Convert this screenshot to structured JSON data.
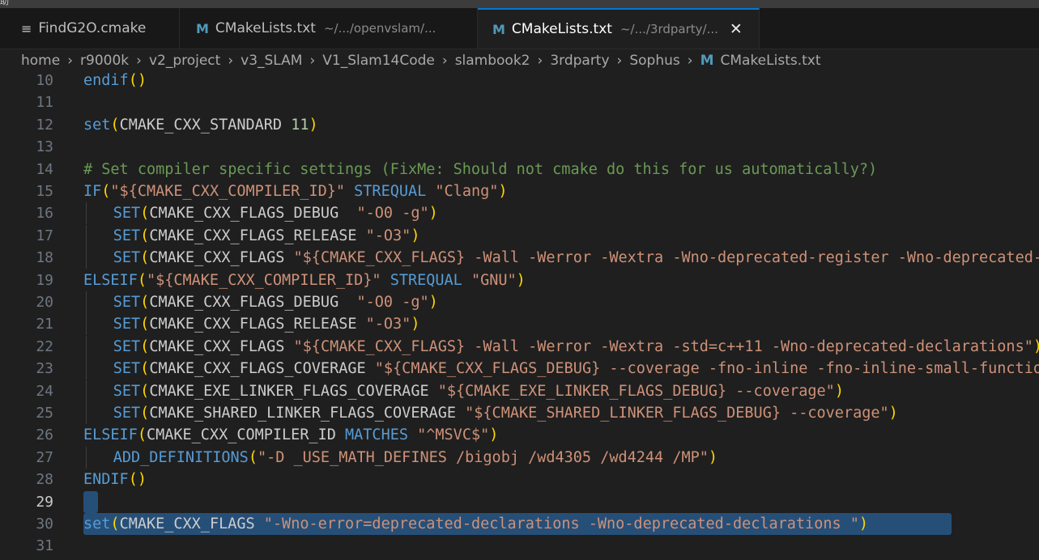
{
  "menubar": {
    "stub_text": "助"
  },
  "tabs": [
    {
      "icon": "≡",
      "icon_name": "list-icon",
      "name": "FindG2O.cmake",
      "path": "",
      "active": false
    },
    {
      "icon": "M",
      "icon_name": "cmake-m-icon",
      "name": "CMakeLists.txt",
      "path": "~/.../openvslam/...",
      "active": false
    },
    {
      "icon": "M",
      "icon_name": "cmake-m-icon",
      "name": "CMakeLists.txt",
      "path": "~/.../3rdparty/...",
      "active": true,
      "close": "✕"
    }
  ],
  "breadcrumb": [
    "home",
    "r9000k",
    "v2_project",
    "v3_SLAM",
    "V1_Slam14Code",
    "slambook2",
    "3rdparty",
    "Sophus"
  ],
  "breadcrumb_file": {
    "icon": "M",
    "name": "CMakeLists.txt"
  },
  "breadcrumb_separator": "›",
  "colors": {
    "keyword": "#569cd6",
    "paren_outer": "#ffd700",
    "paren_inner": "#da70d6",
    "string": "#ce9178",
    "number": "#b5cea8",
    "comment": "#6a9955",
    "selection": "#264f78",
    "accent": "#0078d4",
    "cmake_icon": "#519aba"
  },
  "editor": {
    "current_line": 29,
    "selected_lines": [
      29,
      30
    ],
    "lines": [
      {
        "n": "10",
        "indent": 0,
        "tokens": [
          [
            "kw",
            "endif"
          ],
          [
            "p1",
            "()"
          ]
        ]
      },
      {
        "n": "11",
        "indent": 0,
        "tokens": []
      },
      {
        "n": "12",
        "indent": 0,
        "tokens": [
          [
            "kw",
            "set"
          ],
          [
            "p1",
            "("
          ],
          [
            "plain",
            "CMAKE_CXX_STANDARD "
          ],
          [
            "num",
            "11"
          ],
          [
            "p1",
            ")"
          ]
        ]
      },
      {
        "n": "13",
        "indent": 0,
        "tokens": []
      },
      {
        "n": "14",
        "indent": 0,
        "tokens": [
          [
            "cm",
            "# Set compiler specific settings (FixMe: Should not cmake do this for us automatically?)"
          ]
        ]
      },
      {
        "n": "15",
        "indent": 0,
        "tokens": [
          [
            "kw",
            "IF"
          ],
          [
            "p1",
            "("
          ],
          [
            "str",
            "\"${CMAKE_CXX_COMPILER_ID}\""
          ],
          [
            "plain",
            " "
          ],
          [
            "kw",
            "STREQUAL"
          ],
          [
            "plain",
            " "
          ],
          [
            "str",
            "\"Clang\""
          ],
          [
            "p1",
            ")"
          ]
        ]
      },
      {
        "n": "16",
        "indent": 1,
        "tokens": [
          [
            "kw",
            "SET"
          ],
          [
            "p1",
            "("
          ],
          [
            "plain",
            "CMAKE_CXX_FLAGS_DEBUG  "
          ],
          [
            "str",
            "\"-O0 -g\""
          ],
          [
            "p1",
            ")"
          ]
        ]
      },
      {
        "n": "17",
        "indent": 1,
        "tokens": [
          [
            "kw",
            "SET"
          ],
          [
            "p1",
            "("
          ],
          [
            "plain",
            "CMAKE_CXX_FLAGS_RELEASE "
          ],
          [
            "str",
            "\"-O3\""
          ],
          [
            "p1",
            ")"
          ]
        ]
      },
      {
        "n": "18",
        "indent": 1,
        "tokens": [
          [
            "kw",
            "SET"
          ],
          [
            "p1",
            "("
          ],
          [
            "plain",
            "CMAKE_CXX_FLAGS "
          ],
          [
            "str",
            "\"${CMAKE_CXX_FLAGS} -Wall -Werror -Wextra -Wno-deprecated-register -Wno-deprecated-register\""
          ],
          [
            "p1",
            ")"
          ]
        ]
      },
      {
        "n": "19",
        "indent": 0,
        "tokens": [
          [
            "kw",
            "ELSEIF"
          ],
          [
            "p1",
            "("
          ],
          [
            "str",
            "\"${CMAKE_CXX_COMPILER_ID}\""
          ],
          [
            "plain",
            " "
          ],
          [
            "kw",
            "STREQUAL"
          ],
          [
            "plain",
            " "
          ],
          [
            "str",
            "\"GNU\""
          ],
          [
            "p1",
            ")"
          ]
        ]
      },
      {
        "n": "20",
        "indent": 1,
        "tokens": [
          [
            "kw",
            "SET"
          ],
          [
            "p1",
            "("
          ],
          [
            "plain",
            "CMAKE_CXX_FLAGS_DEBUG  "
          ],
          [
            "str",
            "\"-O0 -g\""
          ],
          [
            "p1",
            ")"
          ]
        ]
      },
      {
        "n": "21",
        "indent": 1,
        "tokens": [
          [
            "kw",
            "SET"
          ],
          [
            "p1",
            "("
          ],
          [
            "plain",
            "CMAKE_CXX_FLAGS_RELEASE "
          ],
          [
            "str",
            "\"-O3\""
          ],
          [
            "p1",
            ")"
          ]
        ]
      },
      {
        "n": "22",
        "indent": 1,
        "tokens": [
          [
            "kw",
            "SET"
          ],
          [
            "p1",
            "("
          ],
          [
            "plain",
            "CMAKE_CXX_FLAGS "
          ],
          [
            "str",
            "\"${CMAKE_CXX_FLAGS} -Wall -Werror -Wextra -std=c++11 -Wno-deprecated-declarations\""
          ],
          [
            "p1",
            ")"
          ]
        ]
      },
      {
        "n": "23",
        "indent": 1,
        "tokens": [
          [
            "kw",
            "SET"
          ],
          [
            "p1",
            "("
          ],
          [
            "plain",
            "CMAKE_CXX_FLAGS_COVERAGE "
          ],
          [
            "str",
            "\"${CMAKE_CXX_FLAGS_DEBUG} --coverage -fno-inline -fno-inline-small-functions\""
          ],
          [
            "p1",
            ")"
          ]
        ]
      },
      {
        "n": "24",
        "indent": 1,
        "tokens": [
          [
            "kw",
            "SET"
          ],
          [
            "p1",
            "("
          ],
          [
            "plain",
            "CMAKE_EXE_LINKER_FLAGS_COVERAGE "
          ],
          [
            "str",
            "\"${CMAKE_EXE_LINKER_FLAGS_DEBUG} --coverage\""
          ],
          [
            "p1",
            ")"
          ]
        ]
      },
      {
        "n": "25",
        "indent": 1,
        "tokens": [
          [
            "kw",
            "SET"
          ],
          [
            "p1",
            "("
          ],
          [
            "plain",
            "CMAKE_SHARED_LINKER_FLAGS_COVERAGE "
          ],
          [
            "str",
            "\"${CMAKE_SHARED_LINKER_FLAGS_DEBUG} --coverage\""
          ],
          [
            "p1",
            ")"
          ]
        ]
      },
      {
        "n": "26",
        "indent": 0,
        "tokens": [
          [
            "kw",
            "ELSEIF"
          ],
          [
            "p1",
            "("
          ],
          [
            "plain",
            "CMAKE_CXX_COMPILER_ID "
          ],
          [
            "kw",
            "MATCHES"
          ],
          [
            "plain",
            " "
          ],
          [
            "str",
            "\"^MSVC$\""
          ],
          [
            "p1",
            ")"
          ]
        ]
      },
      {
        "n": "27",
        "indent": 1,
        "tokens": [
          [
            "kw",
            "ADD_DEFINITIONS"
          ],
          [
            "p1",
            "("
          ],
          [
            "str",
            "\"-D _USE_MATH_DEFINES /bigobj /wd4305 /wd4244 /MP\""
          ],
          [
            "p1",
            ")"
          ]
        ]
      },
      {
        "n": "28",
        "indent": 0,
        "tokens": [
          [
            "kw",
            "ENDIF"
          ],
          [
            "p1",
            "()"
          ]
        ]
      },
      {
        "n": "29",
        "indent": 0,
        "tokens": []
      },
      {
        "n": "30",
        "indent": 0,
        "tokens": [
          [
            "kw",
            "set"
          ],
          [
            "p1",
            "("
          ],
          [
            "plain",
            "CMAKE_CXX_FLAGS "
          ],
          [
            "str",
            "\"-Wno-error=deprecated-declarations -Wno-deprecated-declarations \""
          ],
          [
            "p1",
            ")"
          ]
        ]
      },
      {
        "n": "31",
        "indent": 0,
        "tokens": []
      }
    ]
  }
}
